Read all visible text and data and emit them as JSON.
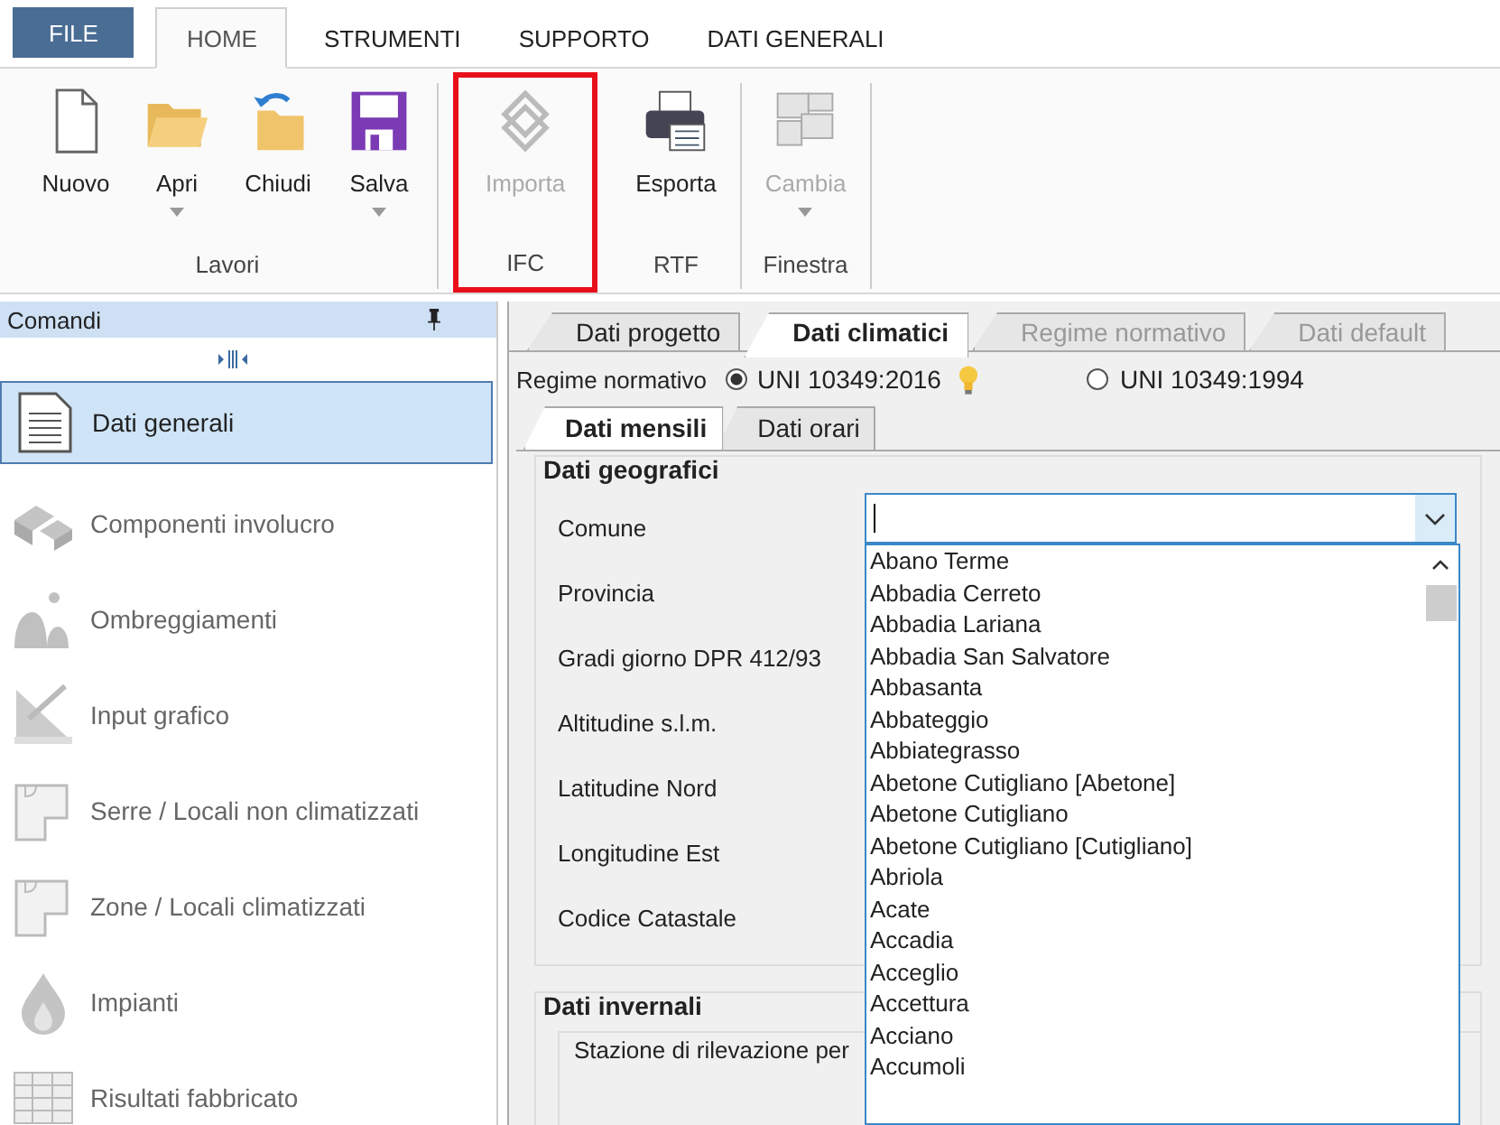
{
  "ribbon_tabs": [
    {
      "label": "FILE",
      "kind": "file",
      "selected": false
    },
    {
      "label": "HOME",
      "kind": "tab",
      "selected": true
    },
    {
      "label": "STRUMENTI",
      "kind": "tab",
      "selected": false
    },
    {
      "label": "SUPPORTO",
      "kind": "tab",
      "selected": false
    },
    {
      "label": "DATI GENERALI",
      "kind": "tab",
      "selected": false
    }
  ],
  "ribbon_groups": [
    {
      "label": "Lavori",
      "highlighted": false,
      "buttons": [
        {
          "label": "Nuovo",
          "disabled": false,
          "has_menu": false
        },
        {
          "label": "Apri",
          "disabled": false,
          "has_menu": true
        },
        {
          "label": "Chiudi",
          "disabled": false,
          "has_menu": false
        },
        {
          "label": "Salva",
          "disabled": false,
          "has_menu": true
        }
      ]
    },
    {
      "label": "IFC",
      "highlighted": true,
      "buttons": [
        {
          "label": "Importa",
          "disabled": true,
          "has_menu": false
        }
      ]
    },
    {
      "label": "RTF",
      "highlighted": false,
      "buttons": [
        {
          "label": "Esporta",
          "disabled": false,
          "has_menu": false
        }
      ]
    },
    {
      "label": "Finestra",
      "highlighted": false,
      "buttons": [
        {
          "label": "Cambia",
          "disabled": true,
          "has_menu": true
        }
      ]
    }
  ],
  "sidebar": {
    "title": "Comandi",
    "items": [
      {
        "label": "Dati generali",
        "selected": true,
        "disabled": false
      },
      {
        "label": "Componenti involucro",
        "selected": false,
        "disabled": true
      },
      {
        "label": "Ombreggiamenti",
        "selected": false,
        "disabled": true
      },
      {
        "label": "Input grafico",
        "selected": false,
        "disabled": true
      },
      {
        "label": "Serre / Locali non climatizzati",
        "selected": false,
        "disabled": true
      },
      {
        "label": "Zone / Locali climatizzati",
        "selected": false,
        "disabled": true
      },
      {
        "label": "Impianti",
        "selected": false,
        "disabled": true
      },
      {
        "label": "Risultati fabbricato",
        "selected": false,
        "disabled": true
      }
    ]
  },
  "tabs": [
    {
      "label": "Dati progetto",
      "selected": false,
      "disabled": false
    },
    {
      "label": "Dati climatici",
      "selected": true,
      "disabled": false
    },
    {
      "label": "Regime normativo",
      "selected": false,
      "disabled": true
    },
    {
      "label": "Dati default",
      "selected": false,
      "disabled": true
    }
  ],
  "regime": {
    "label": "Regime normativo",
    "options": [
      {
        "label": "UNI 10349:2016",
        "selected": true,
        "hint": true
      },
      {
        "label": "UNI 10349:1994",
        "selected": false,
        "hint": false
      }
    ]
  },
  "subtabs": [
    {
      "label": "Dati mensili",
      "selected": true
    },
    {
      "label": "Dati orari",
      "selected": false
    }
  ],
  "dati_geografici": {
    "title": "Dati geografici",
    "fields": [
      "Comune",
      "Provincia",
      "Gradi giorno DPR 412/93",
      "Altitudine s.l.m.",
      "Latitudine Nord",
      "Longitudine Est",
      "Codice Catastale"
    ]
  },
  "comune_dropdown": {
    "expanded": true,
    "options": [
      "Abano Terme",
      "Abbadia Cerreto",
      "Abbadia Lariana",
      "Abbadia San Salvatore",
      "Abbasanta",
      "Abbateggio",
      "Abbiategrasso",
      "Abetone Cutigliano [Abetone]",
      "Abetone Cutigliano",
      "Abetone Cutigliano [Cutigliano]",
      "Abriola",
      "Acate",
      "Accadia",
      "Acceglio",
      "Accettura",
      "Acciano",
      "Accumoli"
    ]
  },
  "dati_invernali": {
    "title": "Dati invernali",
    "fields": [
      "Stazione di rilevazione per"
    ]
  }
}
